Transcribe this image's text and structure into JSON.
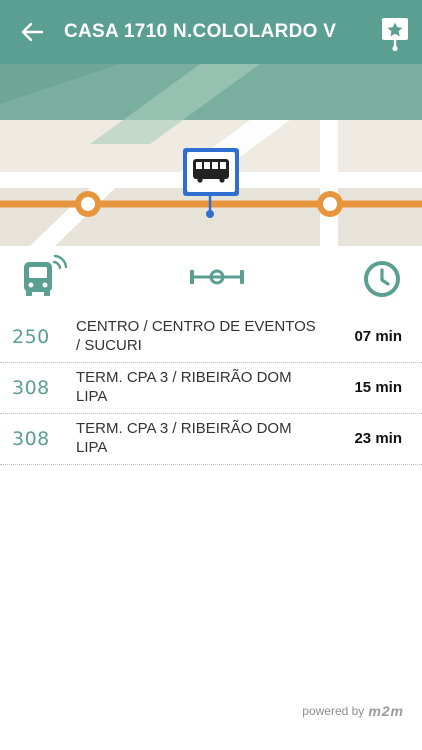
{
  "header": {
    "title": "CASA 1710 N.COLOLARDO V",
    "back_icon": "arrow-left-icon",
    "favorite_icon": "star-pin-icon"
  },
  "colors": {
    "primary": "#5b9f93",
    "route_line": "#e8963d",
    "stop_blue": "#2f6fd1"
  },
  "columns": {
    "line_icon": "bus-realtime-icon",
    "route_icon": "route-icon",
    "time_icon": "clock-icon"
  },
  "arrivals": [
    {
      "line": "250",
      "destination": "CENTRO / CENTRO DE EVENTOS / SUCURI",
      "eta": "07 min"
    },
    {
      "line": "308",
      "destination": "TERM. CPA 3 / RIBEIRÃO DOM LIPA",
      "eta": "15 min"
    },
    {
      "line": "308",
      "destination": "TERM. CPA 3 / RIBEIRÃO DOM LIPA",
      "eta": "23 min"
    }
  ],
  "footer": {
    "powered_by": "powered by",
    "brand": "m2m"
  }
}
